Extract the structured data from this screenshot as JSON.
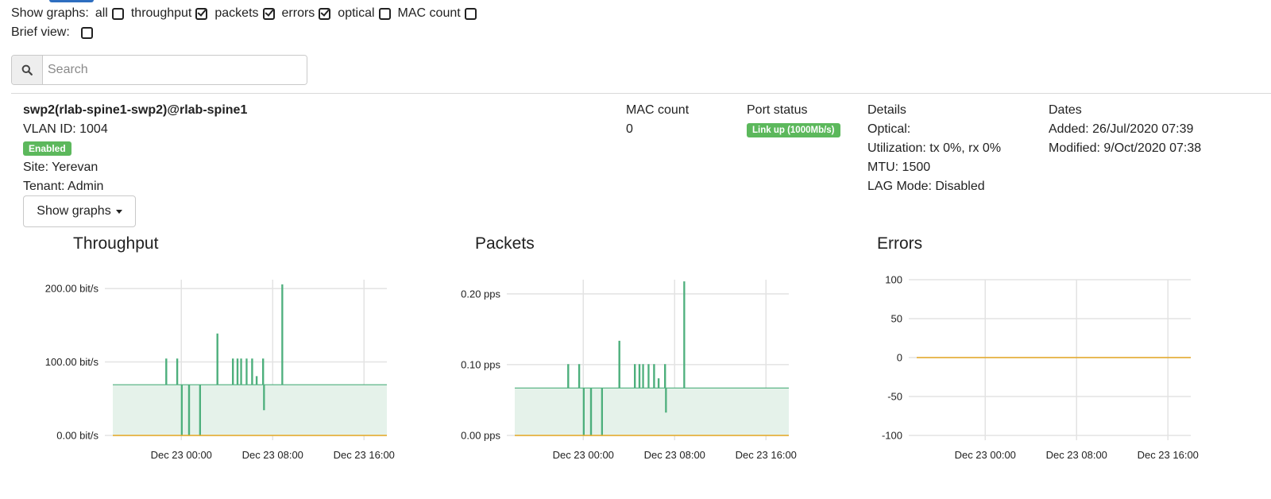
{
  "filters": {
    "label": "Show graphs:",
    "options": [
      {
        "label": "all",
        "checked": false
      },
      {
        "label": "throughput",
        "checked": true
      },
      {
        "label": "packets",
        "checked": true
      },
      {
        "label": "errors",
        "checked": true
      },
      {
        "label": "optical",
        "checked": false
      },
      {
        "label": "MAC count",
        "checked": false
      }
    ],
    "brief_label": "Brief view:",
    "brief_checked": false
  },
  "search": {
    "placeholder": "Search",
    "value": ""
  },
  "port": {
    "name": "swp2(rlab-spine1-swp2)@rlab-spine1",
    "vlan": "VLAN ID: 1004",
    "enabled_badge": "Enabled",
    "site": "Site: Yerevan",
    "tenant": "Tenant: Admin"
  },
  "mac": {
    "header": "MAC count",
    "value": "0"
  },
  "port_status": {
    "header": "Port status",
    "badge": "Link up (1000Mb/s)"
  },
  "details": {
    "header": "Details",
    "optical": "Optical:",
    "utilization": "Utilization: tx 0%, rx 0%",
    "mtu": "MTU: 1500",
    "lag": "LAG Mode: Disabled"
  },
  "dates": {
    "header": "Dates",
    "added": "Added: 26/Jul/2020 07:39",
    "modified": "Modified: 9/Oct/2020 07:38"
  },
  "show_graphs_button": "Show graphs",
  "colors": {
    "accent": "#2e6ec0",
    "success": "#5cb85c",
    "series_green": "#4daf7c",
    "series_orange": "#e5a823",
    "fill_green": "#e5f2ea"
  },
  "chart_data": [
    {
      "type": "area",
      "title": "Throughput",
      "unit": "bit/s",
      "ytick_labels": [
        "0.00 bit/s",
        "100.00 bit/s",
        "200.00 bit/s"
      ],
      "yticks": [
        0,
        100,
        200
      ],
      "ylim": [
        0,
        212
      ],
      "xlim": [
        -7.5,
        22.5
      ],
      "xticks": [
        0,
        10,
        20
      ],
      "xtick_labels": [
        "Dec 23 00:00",
        "Dec 23 08:00",
        "Dec 23 16:00"
      ],
      "series": [
        {
          "color": "#4daf7c",
          "filled": true,
          "points": [
            [
              -7.5,
              69
            ],
            [
              -1.7,
              69
            ],
            [
              -1.7,
              104
            ],
            [
              -1.6,
              104
            ],
            [
              -1.6,
              69
            ],
            [
              -0.5,
              69
            ],
            [
              -0.5,
              104
            ],
            [
              -0.4,
              104
            ],
            [
              -0.4,
              69
            ],
            [
              0,
              69
            ],
            [
              0,
              0
            ],
            [
              0.1,
              0
            ],
            [
              0.1,
              69
            ],
            [
              0.8,
              69
            ],
            [
              0.8,
              0
            ],
            [
              0.9,
              0
            ],
            [
              0.9,
              69
            ],
            [
              2.0,
              69
            ],
            [
              2.0,
              0
            ],
            [
              2.1,
              0
            ],
            [
              2.1,
              69
            ],
            [
              3.9,
              69
            ],
            [
              3.9,
              138
            ],
            [
              4.0,
              138
            ],
            [
              4.0,
              69
            ],
            [
              5.6,
              69
            ],
            [
              5.6,
              104
            ],
            [
              5.7,
              104
            ],
            [
              5.7,
              69
            ],
            [
              6.1,
              69
            ],
            [
              6.1,
              104
            ],
            [
              6.2,
              104
            ],
            [
              6.2,
              69
            ],
            [
              6.5,
              69
            ],
            [
              6.5,
              104
            ],
            [
              6.6,
              104
            ],
            [
              6.6,
              69
            ],
            [
              7.1,
              69
            ],
            [
              7.1,
              104
            ],
            [
              7.2,
              104
            ],
            [
              7.2,
              69
            ],
            [
              7.7,
              69
            ],
            [
              7.7,
              104
            ],
            [
              7.8,
              104
            ],
            [
              7.8,
              69
            ],
            [
              8.2,
              69
            ],
            [
              8.2,
              80
            ],
            [
              8.3,
              80
            ],
            [
              8.3,
              69
            ],
            [
              8.9,
              69
            ],
            [
              8.9,
              104
            ],
            [
              9.0,
              104
            ],
            [
              9.0,
              35
            ],
            [
              9.1,
              35
            ],
            [
              9.1,
              69
            ],
            [
              11.0,
              69
            ],
            [
              11.0,
              205
            ],
            [
              11.1,
              205
            ],
            [
              11.1,
              69
            ],
            [
              22.5,
              69
            ]
          ]
        },
        {
          "color": "#e5a823",
          "filled": false,
          "points": [
            [
              -7.5,
              0
            ],
            [
              22.5,
              0
            ]
          ]
        }
      ]
    },
    {
      "type": "area",
      "title": "Packets",
      "unit": "pps",
      "ytick_labels": [
        "0.00 pps",
        "0.10 pps",
        "0.20 pps"
      ],
      "yticks": [
        0,
        0.1,
        0.2
      ],
      "ylim": [
        0,
        0.22
      ],
      "xlim": [
        -7.5,
        22.5
      ],
      "xticks": [
        0,
        10,
        20
      ],
      "xtick_labels": [
        "Dec 23 00:00",
        "Dec 23 08:00",
        "Dec 23 16:00"
      ],
      "series": [
        {
          "color": "#4daf7c",
          "filled": true,
          "points": [
            [
              -7.5,
              0.067
            ],
            [
              -1.7,
              0.067
            ],
            [
              -1.7,
              0.1
            ],
            [
              -1.6,
              0.1
            ],
            [
              -1.6,
              0.067
            ],
            [
              -0.5,
              0.067
            ],
            [
              -0.5,
              0.1
            ],
            [
              -0.4,
              0.1
            ],
            [
              -0.4,
              0.067
            ],
            [
              0,
              0.067
            ],
            [
              0,
              0
            ],
            [
              0.1,
              0
            ],
            [
              0.1,
              0.067
            ],
            [
              0.8,
              0.067
            ],
            [
              0.8,
              0
            ],
            [
              0.9,
              0
            ],
            [
              0.9,
              0.067
            ],
            [
              2.0,
              0.067
            ],
            [
              2.0,
              0
            ],
            [
              2.1,
              0
            ],
            [
              2.1,
              0.067
            ],
            [
              3.9,
              0.067
            ],
            [
              3.9,
              0.133
            ],
            [
              4.0,
              0.133
            ],
            [
              4.0,
              0.067
            ],
            [
              5.6,
              0.067
            ],
            [
              5.6,
              0.1
            ],
            [
              5.7,
              0.1
            ],
            [
              5.7,
              0.067
            ],
            [
              6.1,
              0.067
            ],
            [
              6.1,
              0.1
            ],
            [
              6.2,
              0.1
            ],
            [
              6.2,
              0.067
            ],
            [
              6.5,
              0.067
            ],
            [
              6.5,
              0.1
            ],
            [
              6.6,
              0.1
            ],
            [
              6.6,
              0.067
            ],
            [
              7.1,
              0.067
            ],
            [
              7.1,
              0.1
            ],
            [
              7.2,
              0.1
            ],
            [
              7.2,
              0.067
            ],
            [
              7.7,
              0.067
            ],
            [
              7.7,
              0.1
            ],
            [
              7.8,
              0.1
            ],
            [
              7.8,
              0.067
            ],
            [
              8.2,
              0.067
            ],
            [
              8.2,
              0.08
            ],
            [
              8.3,
              0.08
            ],
            [
              8.3,
              0.067
            ],
            [
              8.9,
              0.067
            ],
            [
              8.9,
              0.1
            ],
            [
              9.0,
              0.1
            ],
            [
              9.0,
              0.033
            ],
            [
              9.1,
              0.033
            ],
            [
              9.1,
              0.067
            ],
            [
              11.0,
              0.067
            ],
            [
              11.0,
              0.217
            ],
            [
              11.1,
              0.217
            ],
            [
              11.1,
              0.067
            ],
            [
              22.5,
              0.067
            ]
          ]
        },
        {
          "color": "#e5a823",
          "filled": false,
          "points": [
            [
              -7.5,
              0
            ],
            [
              22.5,
              0
            ]
          ]
        }
      ]
    },
    {
      "type": "line",
      "title": "Errors",
      "ytick_labels": [
        "-100",
        "-50",
        "0",
        "50",
        "100"
      ],
      "yticks": [
        -100,
        -50,
        0,
        50,
        100
      ],
      "ylim": [
        -100,
        100
      ],
      "xlim": [
        -7.5,
        22.5
      ],
      "xticks": [
        0,
        10,
        20
      ],
      "xtick_labels": [
        "Dec 23 00:00",
        "Dec 23 08:00",
        "Dec 23 16:00"
      ],
      "series": [
        {
          "color": "#e5a823",
          "filled": false,
          "points": [
            [
              -7.5,
              0
            ],
            [
              22.5,
              0
            ]
          ]
        }
      ]
    }
  ]
}
